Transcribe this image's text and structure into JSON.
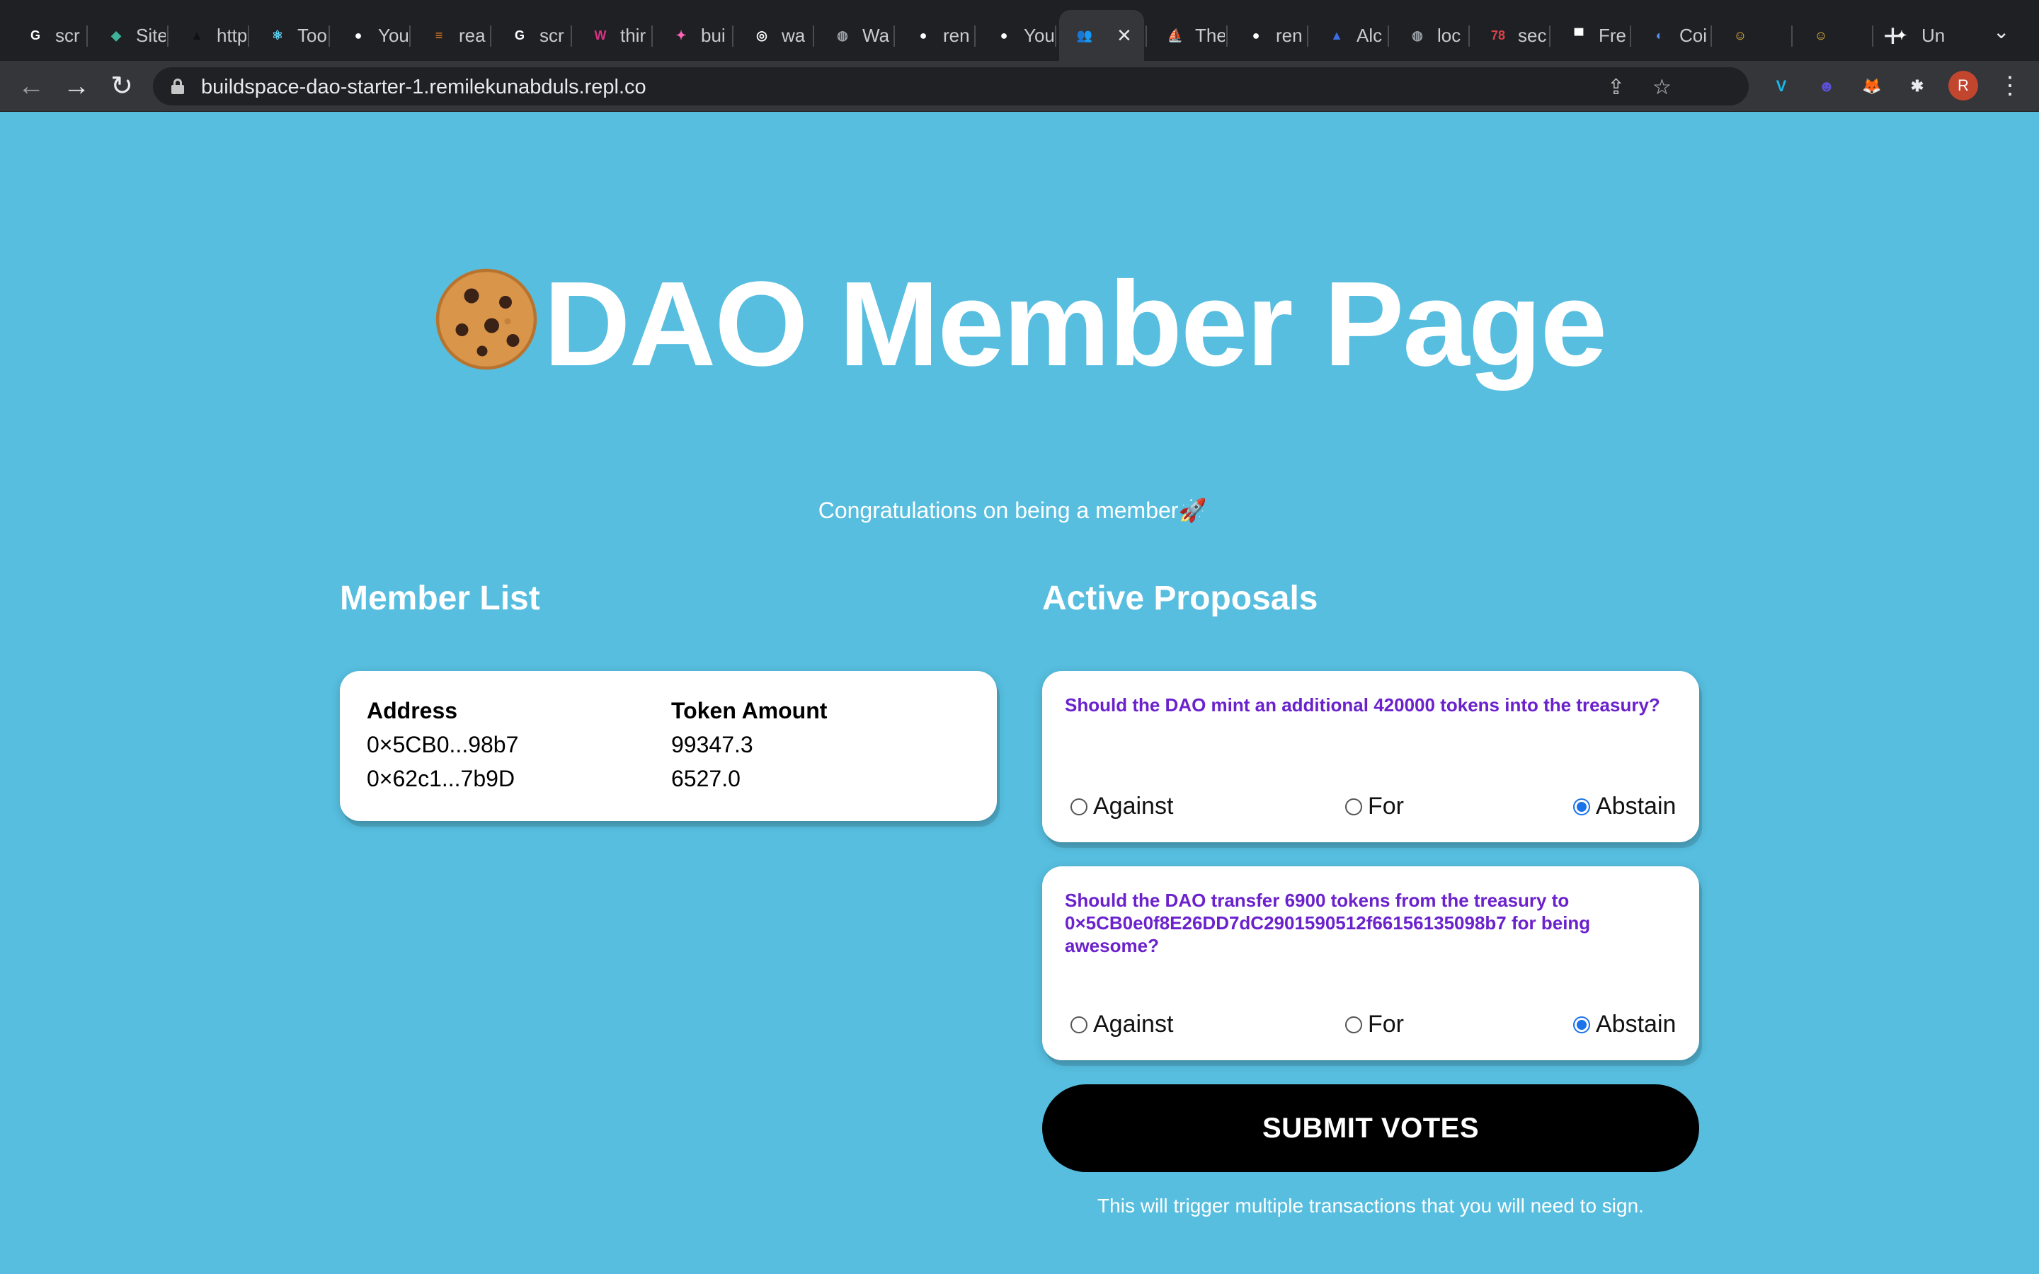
{
  "browser": {
    "tabs": [
      {
        "label": "scr",
        "icon": "google-icon",
        "color": "#ffffff"
      },
      {
        "label": "Site",
        "icon": "diamond-icon",
        "color": "#3fb39a"
      },
      {
        "label": "http",
        "icon": "triangle-icon",
        "color": "#111111"
      },
      {
        "label": "Too",
        "icon": "react-icon",
        "color": "#61dafb"
      },
      {
        "label": "You",
        "icon": "github-icon",
        "color": "#ffffff"
      },
      {
        "label": "rea",
        "icon": "stackoverflow-icon",
        "color": "#f48024"
      },
      {
        "label": "scr",
        "icon": "google-icon",
        "color": "#ffffff"
      },
      {
        "label": "thir",
        "icon": "thirdweb-icon",
        "color": "#d63384"
      },
      {
        "label": "bui",
        "icon": "unicorn-icon",
        "color": "#ff63b8"
      },
      {
        "label": "wa",
        "icon": "spiral-icon",
        "color": "#ffffff"
      },
      {
        "label": "Wa",
        "icon": "globe-icon",
        "color": "#9aa0a6"
      },
      {
        "label": "ren",
        "icon": "github-icon",
        "color": "#ffffff"
      },
      {
        "label": "You",
        "icon": "github-icon",
        "color": "#ffffff"
      },
      {
        "label": "",
        "icon": "people-icon",
        "color": "#7b4cf2",
        "active": true
      },
      {
        "label": "The",
        "icon": "ship-icon",
        "color": "#3b7be0"
      },
      {
        "label": "ren",
        "icon": "github-icon",
        "color": "#ffffff"
      },
      {
        "label": "Alc",
        "icon": "alchemy-icon",
        "color": "#3b6fe6"
      },
      {
        "label": "loc",
        "icon": "globe-icon",
        "color": "#9aa0a6"
      },
      {
        "label": "sec",
        "icon": "badge-78-icon",
        "color": "#d9434b"
      },
      {
        "label": "Fre",
        "icon": "box-icon",
        "color": "#ffffff"
      },
      {
        "label": "Coi",
        "icon": "moon-icon",
        "color": "#5b8def"
      },
      {
        "label": "",
        "icon": "smiley-icon",
        "color": "#f6c344"
      },
      {
        "label": "",
        "icon": "smiley-icon",
        "color": "#f6c344"
      },
      {
        "label": "Un",
        "icon": "unicorn-icon",
        "color": "#ffffff"
      }
    ],
    "url": "buildspace-dao-starter-1.remilekunabduls.repl.co",
    "profile_initial": "R",
    "extensions": [
      {
        "name": "vimeo-icon",
        "glyph": "V",
        "color": "#1ab7ea"
      },
      {
        "name": "ghost-icon",
        "glyph": "☻",
        "color": "#5b4fd8"
      },
      {
        "name": "metamask-icon",
        "glyph": "🦊",
        "color": "#e2761b"
      },
      {
        "name": "puzzle-icon",
        "glyph": "✱",
        "color": "#e8eaed"
      }
    ]
  },
  "page": {
    "title": "DAO Member Page",
    "subtitle": "Congratulations on being a member🚀",
    "member_list": {
      "heading": "Member List",
      "columns": [
        "Address",
        "Token Amount"
      ],
      "rows": [
        [
          "0×5CB0...98b7",
          "99347.3"
        ],
        [
          "0×62c1...7b9D",
          "6527.0"
        ]
      ]
    },
    "proposals": {
      "heading": "Active Proposals",
      "items": [
        {
          "question": "Should the DAO mint an additional 420000 tokens into the treasury?",
          "options": [
            "Against",
            "For",
            "Abstain"
          ],
          "selected": "Abstain"
        },
        {
          "question": "Should the DAO transfer 6900 tokens from the treasury to 0×5CB0e0f8E26DD7dC2901590512f66156135098b7 for being awesome?",
          "options": [
            "Against",
            "For",
            "Abstain"
          ],
          "selected": "Abstain"
        }
      ]
    },
    "submit_label": "SUBMIT VOTES",
    "submit_hint": "This will trigger multiple transactions that you will need to sign."
  }
}
